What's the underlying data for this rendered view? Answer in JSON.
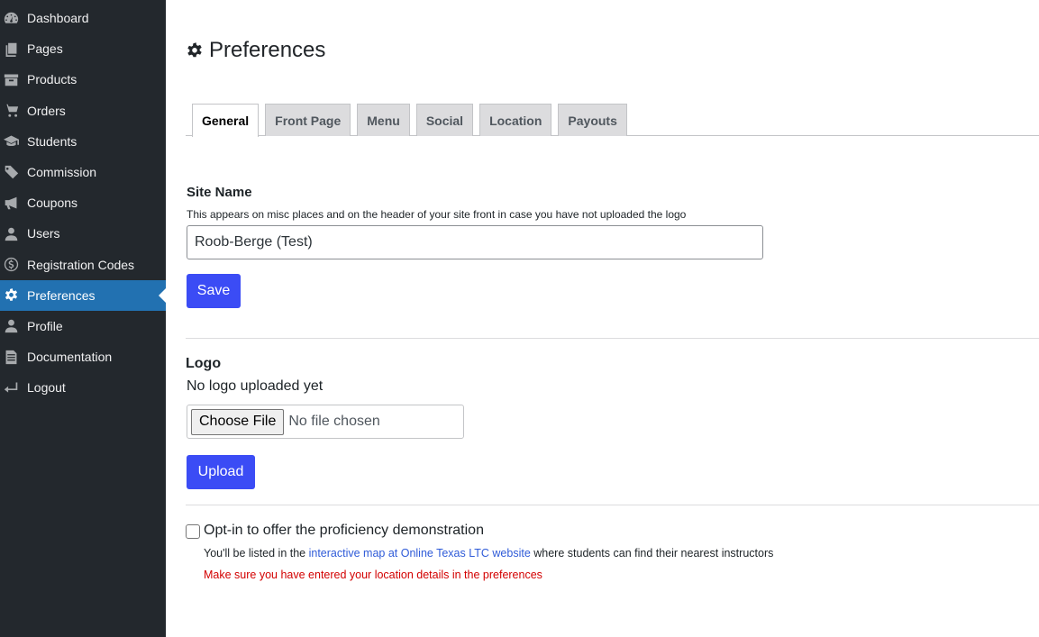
{
  "sidebar": {
    "items": [
      {
        "label": "Dashboard",
        "icon": "dashboard-icon"
      },
      {
        "label": "Pages",
        "icon": "pages-icon"
      },
      {
        "label": "Products",
        "icon": "archive-icon"
      },
      {
        "label": "Orders",
        "icon": "cart-icon"
      },
      {
        "label": "Students",
        "icon": "graduation-cap-icon"
      },
      {
        "label": "Commission",
        "icon": "tags-icon"
      },
      {
        "label": "Coupons",
        "icon": "megaphone-icon"
      },
      {
        "label": "Users",
        "icon": "user-icon"
      },
      {
        "label": "Registration Codes",
        "icon": "dollar-icon"
      },
      {
        "label": "Preferences",
        "icon": "gear-icon",
        "active": true
      },
      {
        "label": "Profile",
        "icon": "user-icon"
      },
      {
        "label": "Documentation",
        "icon": "document-icon"
      },
      {
        "label": "Logout",
        "icon": "return-arrow-icon"
      }
    ]
  },
  "header": {
    "title": "Preferences",
    "icon": "gear-icon"
  },
  "tabs": [
    {
      "label": "General",
      "active": true
    },
    {
      "label": "Front Page"
    },
    {
      "label": "Menu"
    },
    {
      "label": "Social"
    },
    {
      "label": "Location"
    },
    {
      "label": "Payouts"
    }
  ],
  "site_name": {
    "label": "Site Name",
    "help": "This appears on misc places and on the header of your site front in case you have not uploaded the logo",
    "value": "Roob-Berge (Test)",
    "save_label": "Save"
  },
  "logo": {
    "label": "Logo",
    "status": "No logo uploaded yet",
    "choose_file_label": "Choose File",
    "file_status": "No file chosen",
    "upload_label": "Upload"
  },
  "proficiency": {
    "checkbox_label": "Opt-in to offer the proficiency demonstration",
    "checked": false,
    "desc_prefix": "You'll be listed in the ",
    "link_text": "interactive map at Online Texas LTC website",
    "desc_suffix": " where students can find their nearest instructors",
    "warning": "Make sure you have entered your location details in the preferences"
  },
  "colors": {
    "sidebar_bg": "#23282d",
    "active_item": "#2271b1",
    "primary_button": "#3b4cf5",
    "link": "#2f5bd8",
    "warning": "#d30000"
  }
}
